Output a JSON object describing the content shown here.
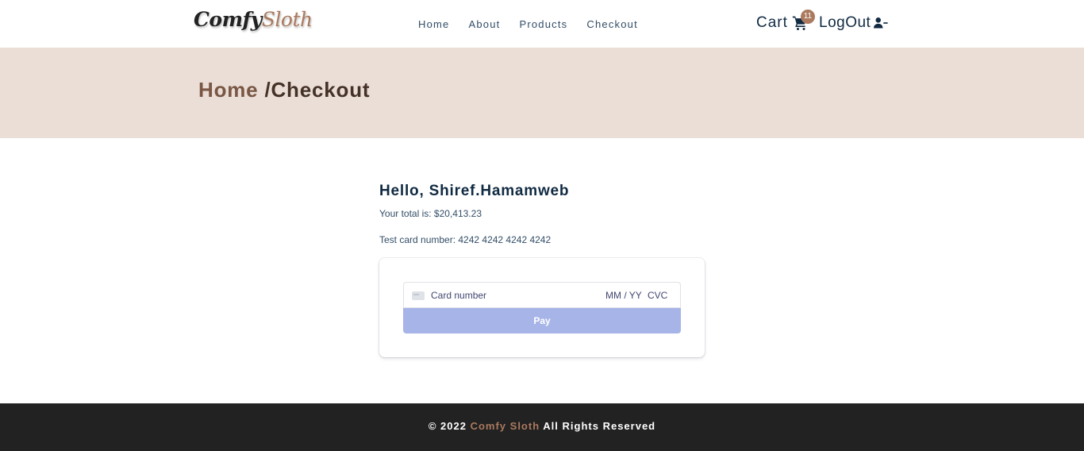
{
  "header": {
    "logo_part1": "Comfy",
    "logo_part2": "Sloth",
    "nav": [
      {
        "label": "Home"
      },
      {
        "label": "About"
      },
      {
        "label": "Products"
      },
      {
        "label": "Checkout"
      }
    ],
    "cart_label": "Cart",
    "cart_count": "11",
    "logout_label": "LogOut"
  },
  "hero": {
    "crumb_home": "Home",
    "crumb_current": " /Checkout"
  },
  "checkout": {
    "greeting": "Hello, Shiref.Hamamweb",
    "total": "Your total is: $20,413.23",
    "test_card": "Test card number: 4242 4242 4242 4242",
    "card_number_placeholder": "Card number",
    "expiry_placeholder": "MM / YY",
    "cvc_placeholder": "CVC",
    "pay_label": "Pay"
  },
  "footer": {
    "prefix": "© 2022 ",
    "brand": "Comfy Sloth",
    "suffix": "All Rights Reserved"
  },
  "colors": {
    "accent": "#ab7a5f",
    "hero_bg": "#eaded7",
    "pay_button": "#a7b4e8",
    "footer_bg": "#222222"
  },
  "icons": [
    "cart-icon",
    "user-minus-icon",
    "card-brand-icon"
  ]
}
